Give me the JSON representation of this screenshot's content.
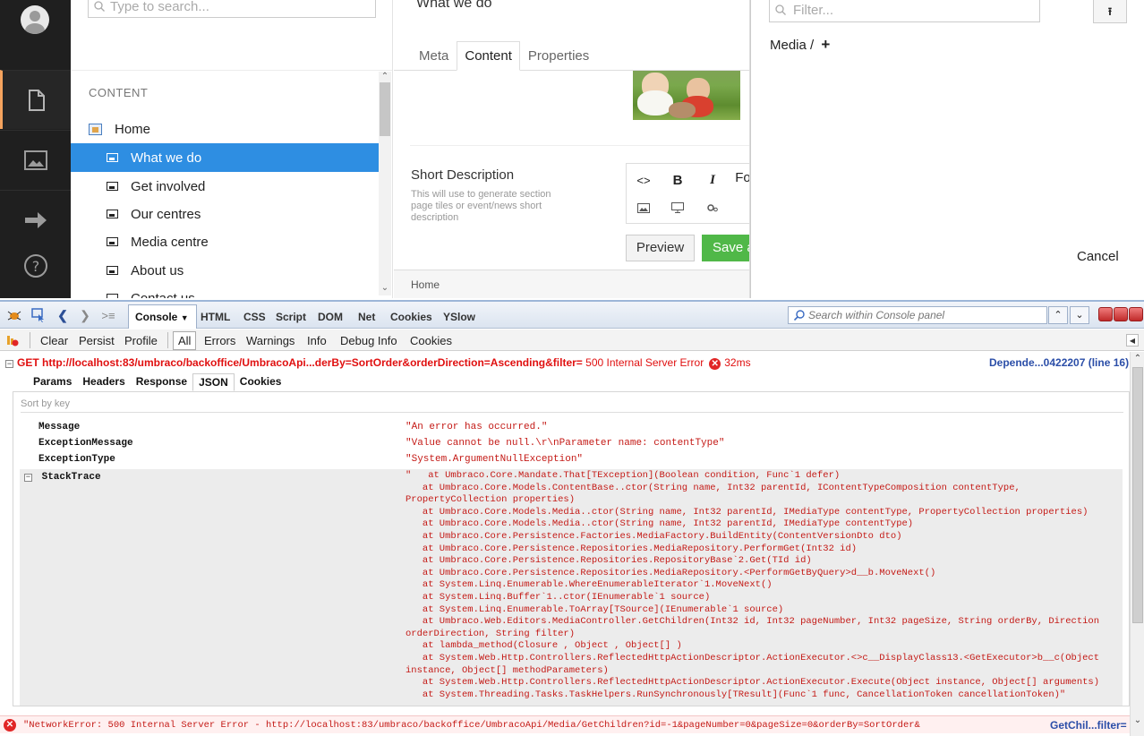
{
  "app": {
    "nav": {
      "items": [
        {
          "name": "content-section",
          "icon": "document-icon"
        },
        {
          "name": "media-section",
          "icon": "image-icon"
        },
        {
          "name": "forms-section",
          "icon": "arrow-right-icon"
        },
        {
          "name": "help",
          "icon": "help-icon"
        }
      ]
    },
    "tree": {
      "search_placeholder": "Type to search...",
      "section_title": "CONTENT",
      "items": [
        {
          "label": "Home"
        },
        {
          "label": "What we do"
        },
        {
          "label": "Get involved"
        },
        {
          "label": "Our centres"
        },
        {
          "label": "Media centre"
        },
        {
          "label": "About us"
        },
        {
          "label": "Contact us"
        }
      ]
    },
    "editor": {
      "page_title": "What we do",
      "tabs": [
        {
          "label": "Meta"
        },
        {
          "label": "Content"
        },
        {
          "label": "Properties"
        }
      ],
      "active_tab": "Content",
      "field_label": "Short Description",
      "field_description": "This will use to generate section page tiles or event/news short description",
      "rte": {
        "source": "<>",
        "bold": "B",
        "italic": "I",
        "format": "Fo"
      },
      "preview_label": "Preview",
      "save_label": "Save a",
      "breadcrumb": "Home"
    },
    "media_picker": {
      "filter_placeholder": "Filter...",
      "upload_symbol": "⭱",
      "breadcrumb": "Media /",
      "add_symbol": "+",
      "cancel_label": "Cancel"
    }
  },
  "firebug": {
    "tabs": [
      {
        "label": "Console"
      },
      {
        "label": "HTML"
      },
      {
        "label": "CSS"
      },
      {
        "label": "Script"
      },
      {
        "label": "DOM"
      },
      {
        "label": "Net"
      },
      {
        "label": "Cookies"
      },
      {
        "label": "YSlow"
      }
    ],
    "search_placeholder": "Search within Console panel",
    "filters": [
      {
        "label": "Clear"
      },
      {
        "label": "Persist"
      },
      {
        "label": "Profile"
      },
      {
        "label": "All"
      },
      {
        "label": "Errors"
      },
      {
        "label": "Warnings"
      },
      {
        "label": "Info"
      },
      {
        "label": "Debug Info"
      },
      {
        "label": "Cookies"
      }
    ],
    "request": {
      "method": "GET",
      "url": "http://localhost:83/umbraco/backoffice/UmbracoApi...derBy=SortOrder&orderDirection=Ascending&filter=",
      "status": "500 Internal Server Error",
      "time": "32ms",
      "source": "Depende...0422207 (line 16)"
    },
    "response_tabs": [
      {
        "label": "Params"
      },
      {
        "label": "Headers"
      },
      {
        "label": "Response"
      },
      {
        "label": "JSON"
      },
      {
        "label": "Cookies"
      }
    ],
    "sort_label": "Sort by key",
    "json": {
      "Message": "\"An error has occurred.\"",
      "ExceptionMessage": "\"Value cannot be null.\\r\\nParameter name: contentType\"",
      "ExceptionType": "\"System.ArgumentNullException\"",
      "StackTrace_key": "StackTrace",
      "StackTrace": "\"   at Umbraco.Core.Mandate.That[TException](Boolean condition, Func`1 defer)\n   at Umbraco.Core.Models.ContentBase..ctor(String name, Int32 parentId, IContentTypeComposition contentType,\nPropertyCollection properties)\n   at Umbraco.Core.Models.Media..ctor(String name, Int32 parentId, IMediaType contentType, PropertyCollection properties)\n   at Umbraco.Core.Models.Media..ctor(String name, Int32 parentId, IMediaType contentType)\n   at Umbraco.Core.Persistence.Factories.MediaFactory.BuildEntity(ContentVersionDto dto)\n   at Umbraco.Core.Persistence.Repositories.MediaRepository.PerformGet(Int32 id)\n   at Umbraco.Core.Persistence.Repositories.RepositoryBase`2.Get(TId id)\n   at Umbraco.Core.Persistence.Repositories.MediaRepository.<PerformGetByQuery>d__b.MoveNext()\n   at System.Linq.Enumerable.WhereEnumerableIterator`1.MoveNext()\n   at System.Linq.Buffer`1..ctor(IEnumerable`1 source)\n   at System.Linq.Enumerable.ToArray[TSource](IEnumerable`1 source)\n   at Umbraco.Web.Editors.MediaController.GetChildren(Int32 id, Int32 pageNumber, Int32 pageSize, String orderBy, Direction\norderDirection, String filter)\n   at lambda_method(Closure , Object , Object[] )\n   at System.Web.Http.Controllers.ReflectedHttpActionDescriptor.ActionExecutor.<>c__DisplayClass13.<GetExecutor>b__c(Object\ninstance, Object[] methodParameters)\n   at System.Web.Http.Controllers.ReflectedHttpActionDescriptor.ActionExecutor.Execute(Object instance, Object[] arguments)\n   at System.Threading.Tasks.TaskHelpers.RunSynchronously[TResult](Func`1 func, CancellationToken cancellationToken)\""
    },
    "network_error": {
      "text": "\"NetworkError: 500 Internal Server Error - http://localhost:83/umbraco/backoffice/UmbracoApi/Media/GetChildren?id=-1&pageNumber=0&pageSize=0&orderBy=SortOrder&",
      "source": "GetChil...filter="
    }
  }
}
